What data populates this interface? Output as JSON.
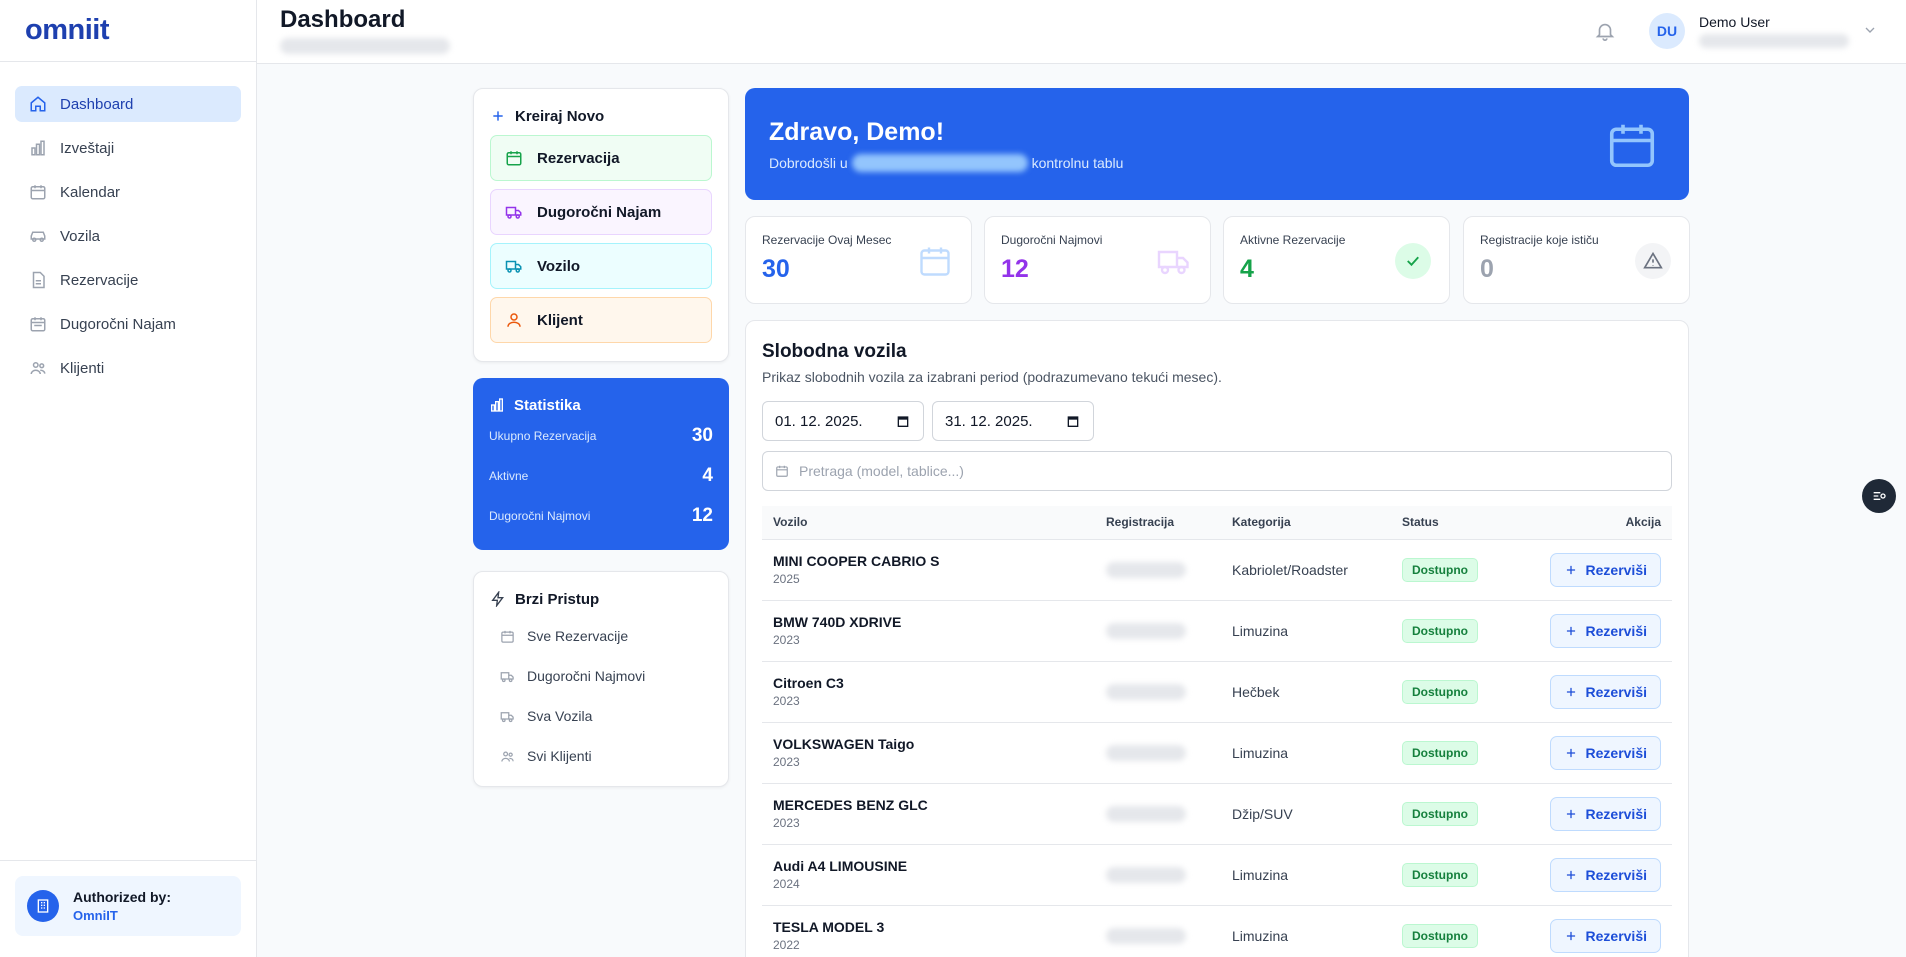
{
  "app": {
    "logo": "omniit"
  },
  "header": {
    "title": "Dashboard",
    "user": {
      "initials": "DU",
      "name": "Demo User"
    }
  },
  "sidebar": {
    "items": [
      {
        "label": "Dashboard",
        "icon": "home-icon",
        "active": true
      },
      {
        "label": "Izveštaji",
        "icon": "bar-chart-icon"
      },
      {
        "label": "Kalendar",
        "icon": "calendar-icon"
      },
      {
        "label": "Vozila",
        "icon": "car-icon"
      },
      {
        "label": "Rezervacije",
        "icon": "document-icon"
      },
      {
        "label": "Dugoročni Najam",
        "icon": "calendar-range-icon"
      },
      {
        "label": "Klijenti",
        "icon": "users-icon"
      }
    ],
    "footer": {
      "label": "Authorized by:",
      "company": "OmniIT"
    }
  },
  "create": {
    "title": "Kreiraj Novo",
    "buttons": [
      {
        "label": "Rezervacija",
        "icon": "calendar-icon",
        "color": "#16a34a"
      },
      {
        "label": "Dugoročni Najam",
        "icon": "truck-icon",
        "color": "#9333ea"
      },
      {
        "label": "Vozilo",
        "icon": "truck-icon",
        "color": "#0891b2"
      },
      {
        "label": "Klijent",
        "icon": "user-icon",
        "color": "#ea580c"
      }
    ]
  },
  "stats": {
    "title": "Statistika",
    "rows": [
      {
        "label": "Ukupno Rezervacija",
        "value": "30"
      },
      {
        "label": "Aktivne",
        "value": "4"
      },
      {
        "label": "Dugoročni Najmovi",
        "value": "12"
      }
    ]
  },
  "quick": {
    "title": "Brzi Pristup",
    "items": [
      {
        "label": "Sve Rezervacije",
        "icon": "calendar-icon"
      },
      {
        "label": "Dugoročni Najmovi",
        "icon": "truck-icon"
      },
      {
        "label": "Sva Vozila",
        "icon": "truck-icon"
      },
      {
        "label": "Svi Klijenti",
        "icon": "users-icon"
      }
    ]
  },
  "welcome": {
    "title": "Zdravo, Demo!",
    "sub_before": "Dobrodošli u",
    "sub_after": "kontrolnu tablu"
  },
  "stat_cards": [
    {
      "label": "Rezervacije Ovaj Mesec",
      "value": "30",
      "color": "#2563eb",
      "icon": "calendar-icon"
    },
    {
      "label": "Dugoročni Najmovi",
      "value": "12",
      "color": "#9333ea",
      "icon": "truck-icon"
    },
    {
      "label": "Aktivne Rezervacije",
      "value": "4",
      "color": "#16a34a",
      "icon": "check-icon"
    },
    {
      "label": "Registracije koje ističu",
      "value": "0",
      "color": "#9ca3af",
      "icon": "warning-icon"
    }
  ],
  "vehicles": {
    "title": "Slobodna vozila",
    "subtitle": "Prikaz slobodnih vozila za izabrani period (podrazumevano tekući mesec).",
    "date_from": "01. 12. 2025.",
    "date_to": "31. 12. 2025.",
    "search_placeholder": "Pretraga (model, tablice...)",
    "columns": [
      "Vozilo",
      "Registracija",
      "Kategorija",
      "Status",
      "Akcija"
    ],
    "action_label": "Rezerviši",
    "rows": [
      {
        "name": "MINI COOPER CABRIO S",
        "year": "2025",
        "category": "Kabriolet/Roadster",
        "status": "Dostupno"
      },
      {
        "name": "BMW 740D XDRIVE",
        "year": "2023",
        "category": "Limuzina",
        "status": "Dostupno"
      },
      {
        "name": "Citroen C3",
        "year": "2023",
        "category": "Hečbek",
        "status": "Dostupno"
      },
      {
        "name": "VOLKSWAGEN Taigo",
        "year": "2023",
        "category": "Limuzina",
        "status": "Dostupno"
      },
      {
        "name": "MERCEDES BENZ GLC",
        "year": "2023",
        "category": "Džip/SUV",
        "status": "Dostupno"
      },
      {
        "name": "Audi A4 LIMOUSINE",
        "year": "2024",
        "category": "Limuzina",
        "status": "Dostupno"
      },
      {
        "name": "TESLA MODEL 3",
        "year": "2022",
        "category": "Limuzina",
        "status": "Dostupno"
      }
    ]
  }
}
